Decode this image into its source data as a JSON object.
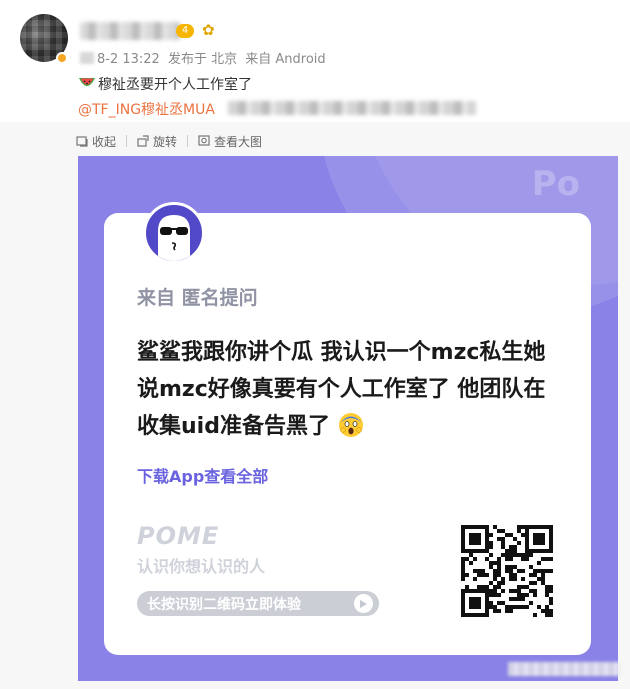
{
  "post": {
    "level_badge": "4",
    "meta": {
      "time": "8-2 13:22",
      "location": "发布于 北京",
      "source": "来自 Android"
    },
    "text": "穆祉丞要开个人工作室了",
    "mention": "@TF_ING穆祉丞MUA"
  },
  "toolbar": {
    "collapse_label": "收起",
    "rotate_label": "旋转",
    "view_large_label": "查看大图"
  },
  "card": {
    "logo": "Po",
    "from_label": "来自 匿名提问",
    "question": "鲨鲨我跟你讲个瓜 我认识一个mzc私生她说mzc好像真要有个人工作室了 他团队在收集uid准备告黑了",
    "download_link": "下载App查看全部",
    "brand": "POME",
    "slogan": "认识你想认识的人",
    "scan_prompt": "长按识别二维码立即体验"
  },
  "colors": {
    "card_background": "#8a82e6",
    "mention": "#eb7340",
    "link": "#6a63df"
  }
}
